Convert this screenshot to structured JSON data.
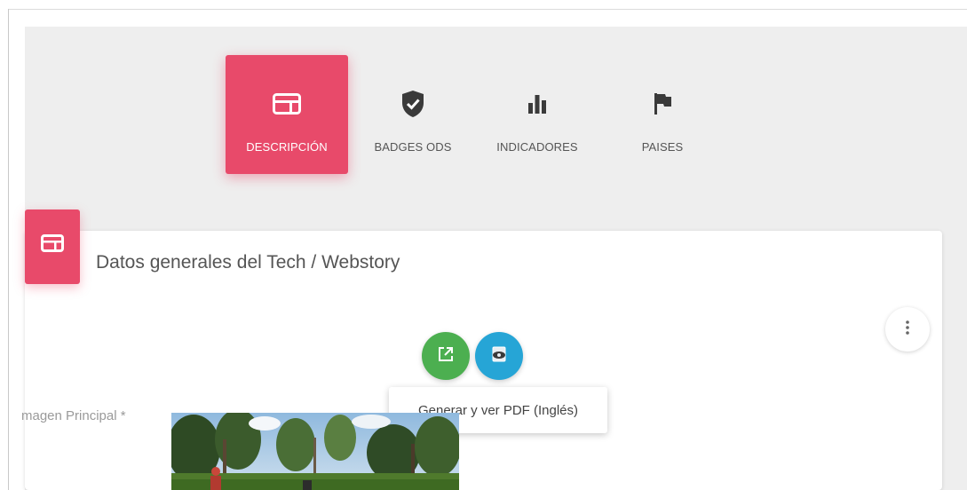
{
  "tabs": [
    {
      "label": "DESCRIPCIÓN",
      "icon": "card-icon",
      "active": true
    },
    {
      "label": "BADGES ODS",
      "icon": "shield-check-icon",
      "active": false
    },
    {
      "label": "INDICADORES",
      "icon": "bar-chart-icon",
      "active": false
    },
    {
      "label": "PAISES",
      "icon": "flag-icon",
      "active": false
    }
  ],
  "card": {
    "title": "Datos generales del Tech / Webstory",
    "icon": "card-icon"
  },
  "actions": {
    "open_icon": "open-external-icon",
    "pdf_icon": "pdf-eye-icon",
    "tooltip": "Generar y ver PDF (Inglés)",
    "more_icon": "more-vert-icon"
  },
  "form": {
    "image_label": "magen Principal *"
  },
  "colors": {
    "accent": "#e84a6a",
    "green": "#4caf50",
    "blue": "#26a5d6",
    "panel": "#eeeeee"
  }
}
